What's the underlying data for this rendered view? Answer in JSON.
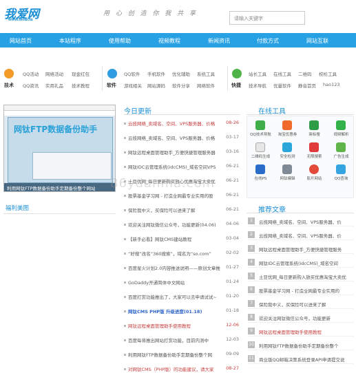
{
  "header": {
    "logo_main": "我爱网",
    "logo_url": "www.woai.la",
    "slogan": "用 心 创 造 你 我 共 享",
    "search_placeholder": "请输入关键字"
  },
  "nav": [
    "网站首页",
    "本站程序",
    "使用帮助",
    "视频教程",
    "新闻资讯",
    "付款方式",
    "网站互联"
  ],
  "quick": {
    "groups": [
      {
        "title": "技术",
        "links": [
          "QQ活动",
          "网络活动",
          "现金红包",
          "QQ资讯",
          "实用礼品",
          "技术教程"
        ]
      },
      {
        "title": "软件",
        "links": [
          "QQ软件",
          "手机软件",
          "优化辅助",
          "系统工具",
          "游戏相关",
          "网站源码",
          "软件分享",
          "网络软件"
        ]
      },
      {
        "title": "快捷",
        "links": [
          "站长工具",
          "在线工具",
          "二维码",
          "校检工具",
          "技术导航",
          "优量软件",
          "静音首页",
          "hao123"
        ]
      }
    ]
  },
  "slide": {
    "caption": "利用网钛FTP数据备份助手定期备份整个网站",
    "win_title": "网钛FTP数据备份助手"
  },
  "fuli_title": "福利美图",
  "today": {
    "title": "今日更新",
    "items": [
      {
        "text": "云技网络_卖域名、空间、VPS服务器、价格",
        "date": "08-26",
        "style": "red"
      },
      {
        "text": "云技网络_卖域名、空间、VPS服务器、价格",
        "date": "03-17",
        "style": ""
      },
      {
        "text": "网钛远程桌面管理助手_方便快捷管理服务器",
        "date": "03-16",
        "style": ""
      },
      {
        "text": "网钛IDC云管理系统(idcCMS)_域名空间VPS",
        "date": "06-21",
        "style": ""
      },
      {
        "text": "土豆优网_每日更新购买放心优惠淘宝大卖优",
        "date": "06-21",
        "style": ""
      },
      {
        "text": "股票基金学习网 - 打造全网最专业实用的股",
        "date": "06-21",
        "style": ""
      },
      {
        "text": "保险我中义，买保险可以进来了解",
        "date": "06-21",
        "style": ""
      },
      {
        "text": "欢迎关注网钛微信公众号，功能更新(04.06)",
        "date": "04-06",
        "style": ""
      },
      {
        "text": "【新手必看】网钛CMS建站教程",
        "date": "03-04",
        "style": ""
      },
      {
        "text": "“好搜”改名“360搜索”，域名为“so.com”",
        "date": "02-02",
        "style": ""
      },
      {
        "text": "百度星火计划2.0内容推送说明——原创文章推",
        "date": "01-27",
        "style": ""
      },
      {
        "text": "GoDaddy开通简体中文网站",
        "date": "01-24",
        "style": ""
      },
      {
        "text": "百度打赏功能推出了，大家可以去申请试试~",
        "date": "01-20",
        "style": ""
      },
      {
        "text": "网钛CMS PHP版 升级进度(01.18)",
        "date": "01-18",
        "style": "blue"
      },
      {
        "text": "网钛远程桌面管理助手使用教程",
        "date": "12-06",
        "style": "red"
      },
      {
        "text": "百度每将推出网站打赏功能，目前内测中",
        "date": "12-03",
        "style": ""
      },
      {
        "text": "利用网钛FTP数据备份助手定期备份整个网",
        "date": "09-09",
        "style": ""
      },
      {
        "text": "对网钛CMS（PHP版）的功能建议，请大家",
        "date": "08-27",
        "style": "red"
      }
    ]
  },
  "tools": {
    "title": "在线工具",
    "items": [
      {
        "label": "QQ技术导航",
        "color": "#3fae49"
      },
      {
        "label": "淘宝优惠券",
        "color": "#f06a2b"
      },
      {
        "label": "商标搜",
        "color": "#2e9e46"
      },
      {
        "label": "视频解析",
        "color": "#33b24a"
      },
      {
        "label": "二维码生成",
        "color": "#e6e6e6"
      },
      {
        "label": "安全检测",
        "color": "#2aa6db"
      },
      {
        "label": "无限搜索",
        "color": "#e03a3a"
      },
      {
        "label": "广告生成",
        "color": "#5fb54a"
      },
      {
        "label": "在线PS",
        "color": "#2a6dc9"
      },
      {
        "label": "网钛编辑",
        "color": "#7f8a96"
      },
      {
        "label": "影片网站",
        "color": "#e34a3a"
      },
      {
        "label": "QQ查询",
        "color": "#36a4e0"
      }
    ]
  },
  "recommend": {
    "title": "推荐文章",
    "items": [
      {
        "n": "1",
        "text": "云技网络_卖域名、空间、VPS服务器、价",
        "style": ""
      },
      {
        "n": "2",
        "text": "云技网络_卖域名、空间、VPS服务器、价",
        "style": ""
      },
      {
        "n": "3",
        "text": "网钛远程桌面管理助手_方便快捷管理服务",
        "style": ""
      },
      {
        "n": "4",
        "text": "网钛IDC云管理系统(idcCMS)_域名空间",
        "style": ""
      },
      {
        "n": "5",
        "text": "土豆优网_每日更新购入放买优惠淘宝大卖优",
        "style": ""
      },
      {
        "n": "6",
        "text": "股票基金学习网 - 打造全网最专业实用的",
        "style": ""
      },
      {
        "n": "7",
        "text": "保险我中义，买保险可以进来了解",
        "style": ""
      },
      {
        "n": "8",
        "text": "欢迎关注网钛微信公众号，功能更新",
        "style": ""
      },
      {
        "n": "9",
        "text": "网钛远程桌面管理助手使用教程",
        "style": "red"
      },
      {
        "n": "10",
        "text": "利用网钛FTP数据备份助手定期备份整个",
        "style": ""
      },
      {
        "n": "11",
        "text": "商业版QQ邮箱决策系统登录API申请提交说",
        "style": ""
      }
    ]
  },
  "watermark": "86ydanma.com"
}
